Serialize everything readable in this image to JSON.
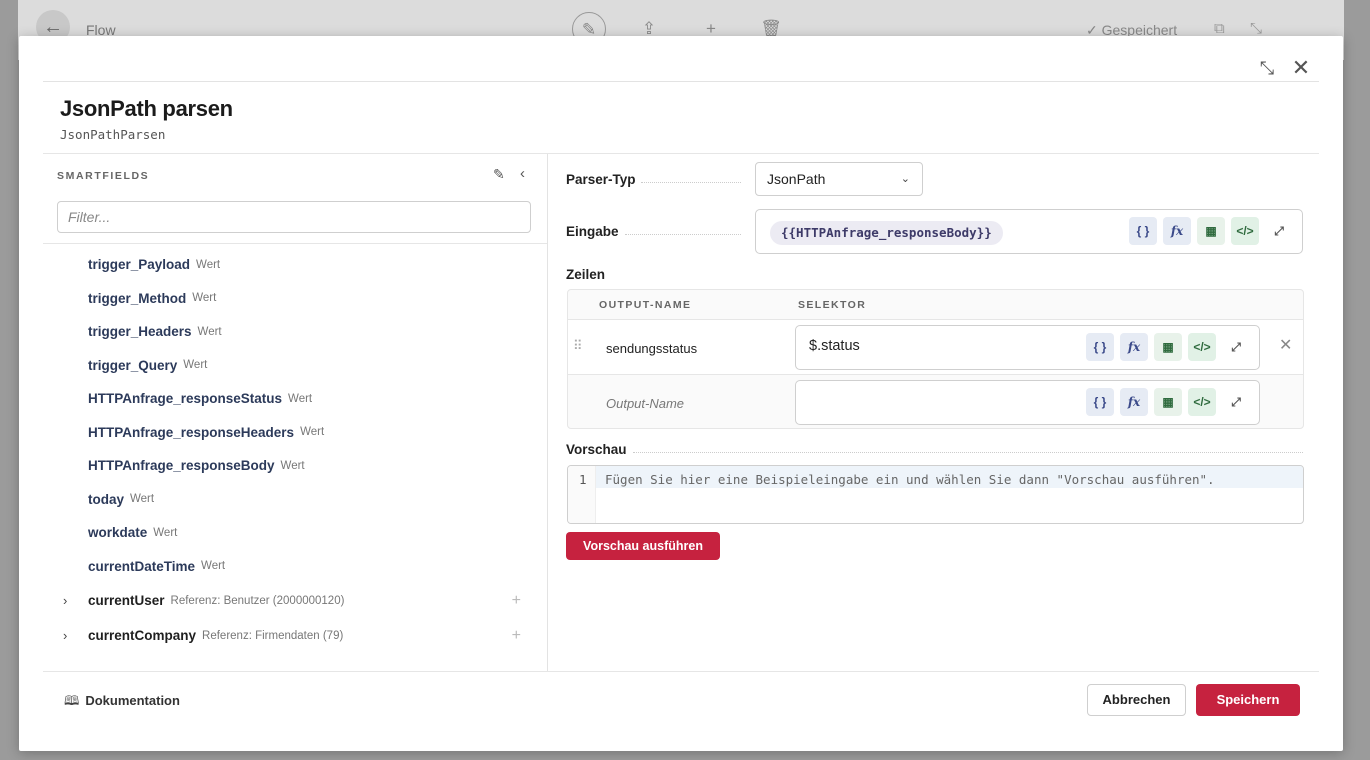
{
  "background": {
    "title": "Flow",
    "saved_status": "✓ Gespeichert",
    "icons": [
      "back-arrow-icon",
      "pencil-icon",
      "share-icon",
      "plus-icon",
      "trash-icon",
      "external-link-icon",
      "collapse-icon"
    ]
  },
  "modal": {
    "title": "JsonPath parsen",
    "subtitle": "JsonPathParsen"
  },
  "smartfields": {
    "heading": "SMARTFIELDS",
    "filter_placeholder": "Filter...",
    "items": [
      {
        "name": "trigger_Payload",
        "type": "Wert"
      },
      {
        "name": "trigger_Method",
        "type": "Wert"
      },
      {
        "name": "trigger_Headers",
        "type": "Wert"
      },
      {
        "name": "trigger_Query",
        "type": "Wert"
      },
      {
        "name": "HTTPAnfrage_responseStatus",
        "type": "Wert"
      },
      {
        "name": "HTTPAnfrage_responseHeaders",
        "type": "Wert"
      },
      {
        "name": "HTTPAnfrage_responseBody",
        "type": "Wert"
      },
      {
        "name": "today",
        "type": "Wert"
      },
      {
        "name": "workdate",
        "type": "Wert"
      },
      {
        "name": "currentDateTime",
        "type": "Wert"
      }
    ],
    "refs": [
      {
        "name": "currentUser",
        "type": "Referenz: Benutzer (2000000120)"
      },
      {
        "name": "currentCompany",
        "type": "Referenz: Firmendaten (79)"
      }
    ]
  },
  "form": {
    "parser_label": "Parser-Typ",
    "parser_value": "JsonPath",
    "input_label": "Eingabe",
    "input_token": "{{HTTPAnfrage_responseBody}}",
    "rows_label": "Zeilen",
    "col_output": "OUTPUT-NAME",
    "col_selector": "SELEKTOR",
    "rows": [
      {
        "output": "sendungsstatus",
        "selector": "$.status"
      }
    ],
    "new_row_placeholder": "Output-Name",
    "preview_label": "Vorschau",
    "preview_line_number": "1",
    "preview_placeholder": "Fügen Sie hier eine Beispieleingabe ein und wählen Sie dann \"Vorschau ausführen\".",
    "run_preview": "Vorschau ausführen",
    "input_buttons": {
      "braces": "{ }",
      "fx": "fx"
    }
  },
  "footer": {
    "doc_link": "Dokumentation",
    "cancel": "Abbrechen",
    "save": "Speichern"
  },
  "colors": {
    "primary": "#c6223f",
    "smartfield_name": "#2c3a5a"
  }
}
